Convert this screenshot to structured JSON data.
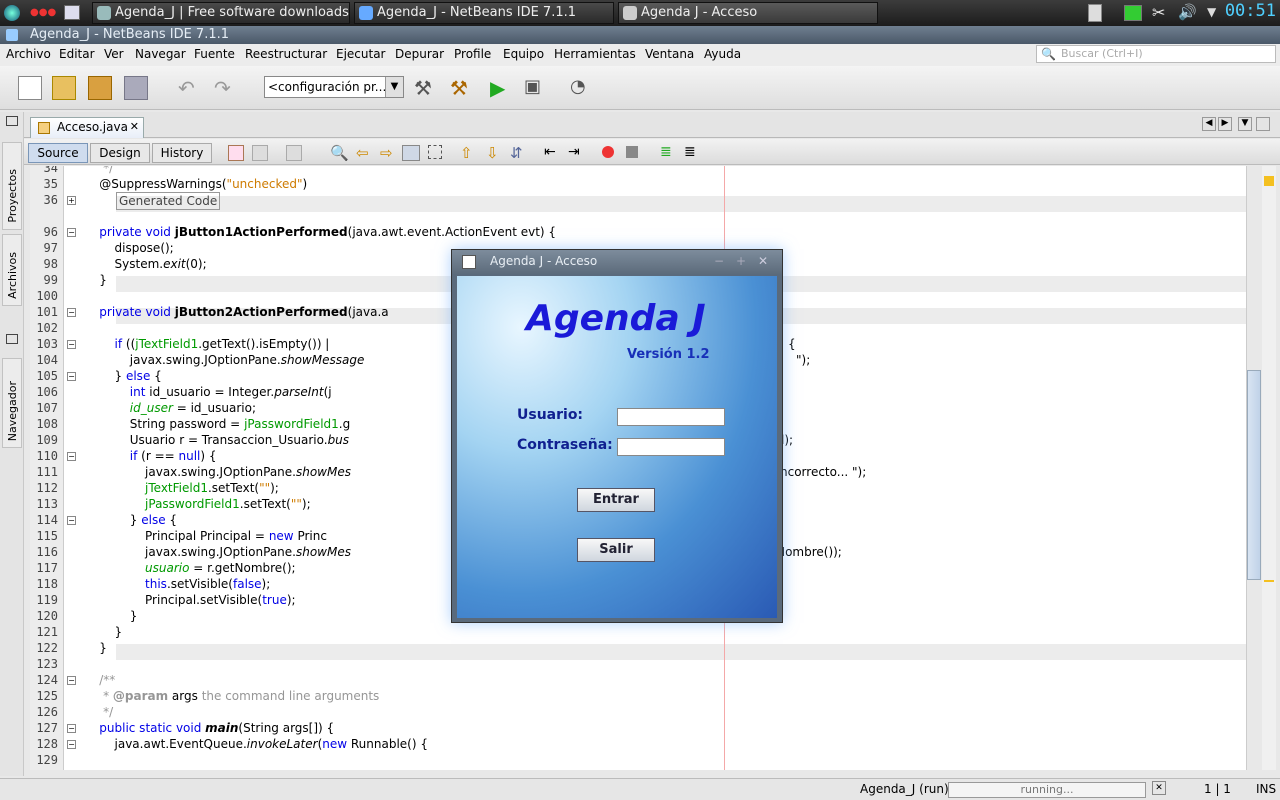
{
  "taskbar": {
    "tasks": [
      "Agenda_J | Free software downloads",
      "Agenda_J - NetBeans IDE 7.1.1",
      "Agenda J - Acceso"
    ],
    "clock": "00:51"
  },
  "window": {
    "title": "Agenda_J - NetBeans IDE 7.1.1"
  },
  "menu": [
    "Archivo",
    "Editar",
    "Ver",
    "Navegar",
    "Fuente",
    "Reestructurar",
    "Ejecutar",
    "Depurar",
    "Profile",
    "Equipo",
    "Herramientas",
    "Ventana",
    "Ayuda"
  ],
  "search": {
    "placeholder": "Buscar (Ctrl+I)"
  },
  "toolbar": {
    "config": "<configuración pr..."
  },
  "side_tabs": {
    "projects": "Proyectos",
    "files": "Archivos",
    "navigator": "Navegador"
  },
  "editor": {
    "file_tab": "Acceso.java",
    "views": {
      "source": "Source",
      "design": "Design",
      "history": "History"
    },
    "line_numbers": [
      "34",
      "35",
      "36",
      "96",
      "97",
      "98",
      "99",
      "100",
      "101",
      "102",
      "103",
      "104",
      "105",
      "106",
      "107",
      "108",
      "109",
      "110",
      "111",
      "112",
      "113",
      "114",
      "115",
      "116",
      "117",
      "118",
      "119",
      "120",
      "121",
      "122",
      "123",
      "124",
      "125",
      "126",
      "127",
      "128",
      "129"
    ],
    "text": {
      "l35a": "    @SuppressWarnings(",
      "l35b": "\"unchecked\"",
      "l35c": ")",
      "l36": "Generated Code",
      "l96a": "    ",
      "l96b": "private void ",
      "l96c": "jButton1ActionPerformed",
      "l96d": "(java.awt.event.ActionEvent evt) {",
      "l97": "        dispose();",
      "l98a": "        System.",
      "l98b": "exit",
      "l98c": "(0);",
      "l99": "    }",
      "l101a": "    ",
      "l101b": "private void ",
      "l101c": "jButton2ActionPerformed",
      "l101d": "(java.a",
      "l103a": "        ",
      "l103b": "if ",
      "l103c": "((",
      "l103d": "jTextField1",
      ".l103e": "",
      "l103f": ".getText().isEmpty()) |",
      "l103g": "{",
      "l104a": "            javax.swing.JOptionPane.",
      "l104b": "showMessage",
      "l104c": "\");",
      "l105a": "        } ",
      "l105b": "else ",
      "l105c": "{",
      "l106a": "            ",
      "l106b": "int ",
      "l106c": "id_usuario = Integer.",
      "l106d": "parseInt",
      "l106e": "(j",
      "l107a": "            ",
      "l107b": "id_user",
      " l107c": "",
      "l107d": " = id_usuario;",
      "l108a": "            String password = ",
      "l108b": "jPasswordField1",
      ".l108c": "",
      "l108d": ".g",
      "l109a": "            Usuario r = Transaccion_Usuario.",
      "l109b": "bus",
      "l109c": "rd);",
      "l110a": "            ",
      "l110b": "if ",
      "l110c": "(r == ",
      "l110d": "null",
      "l110e": ") {",
      "l111a": "                javax.swing.JOptionPane.",
      "l111b": "showMes",
      "l111c": "ncorrecto... \");",
      "l112a": "                ",
      "l112b": "jTextField1",
      "l112c": ".setText(",
      "l112d": "\"\"",
      "l112e": ");",
      "l113a": "                ",
      "l113b": "jPasswordField1",
      "l113c": ".setText(",
      "l113d": "\"\"",
      "l113e": ");",
      "l114a": "            } ",
      "l114b": "else ",
      "l114c": "{",
      "l115a": "                Principal Principal = ",
      "l115b": "new ",
      "l115c": "Princ",
      "l116a": "                javax.swing.JOptionPane.",
      "l116b": "showMes",
      "l116c": "etNombre());",
      "l117a": "                ",
      "l117b": "usuario",
      "l117c": " = r.getNombre();",
      "l118a": "                ",
      "l118b": "this",
      ".l118c": "",
      "l118d": ".setVisible(",
      "l118e": "false",
      "l118f": ");",
      "l119a": "                Principal.setVisible(",
      "l119b": "true",
      "l119c": ");",
      "l120": "            }",
      "l121": "        }",
      "l122": "    }",
      "l124": "    /**",
      "l125a": "     * ",
      "l125b": "@param",
      " l125c": "",
      "l125d": " args ",
      "l125e": "the command line arguments",
      "l126": "     */",
      "l127a": "    ",
      "l127b": "public static void ",
      "l127c": "main",
      "l127d": "(String args[]) {",
      "l128a": "        java.awt.EventQueue.",
      "l128b": "invokeLater",
      "l128c": "(",
      "l128d": "new ",
      "l128e": "Runnable() {",
      "l34": "     */"
    }
  },
  "status": {
    "project": "Agenda_J (run)",
    "progress": "running...",
    "position": "1 | 1",
    "mode": "INS"
  },
  "dialog": {
    "title": "Agenda J - Acceso",
    "heading": "Agenda J",
    "version": "Versión 1.2",
    "user_label": "Usuario:",
    "pass_label": "Contraseña:",
    "enter": "Entrar",
    "exit": "Salir"
  }
}
